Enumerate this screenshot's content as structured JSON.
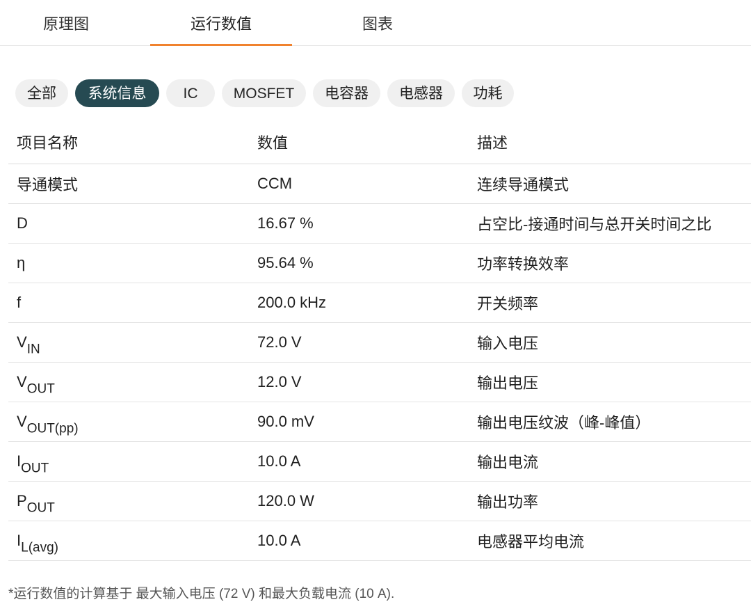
{
  "tabs": [
    {
      "label": "原理图",
      "active": false
    },
    {
      "label": "运行数值",
      "active": true
    },
    {
      "label": "图表",
      "active": false
    }
  ],
  "filters": [
    {
      "label": "全部",
      "active": false
    },
    {
      "label": "系统信息",
      "active": true
    },
    {
      "label": "IC",
      "active": false
    },
    {
      "label": "MOSFET",
      "active": false
    },
    {
      "label": "电容器",
      "active": false
    },
    {
      "label": "电感器",
      "active": false
    },
    {
      "label": "功耗",
      "active": false
    }
  ],
  "table": {
    "headers": [
      "项目名称",
      "数值",
      "描述"
    ],
    "rows": [
      {
        "symbol": "导通模式",
        "sub": "",
        "value": "CCM",
        "desc": "连续导通模式"
      },
      {
        "symbol": "D",
        "sub": "",
        "value": "16.67 %",
        "desc": "占空比-接通时间与总开关时间之比"
      },
      {
        "symbol": "η",
        "sub": "",
        "value": "95.64 %",
        "desc": "功率转换效率"
      },
      {
        "symbol": "f",
        "sub": "",
        "value": "200.0 kHz",
        "desc": "开关频率"
      },
      {
        "symbol": "V",
        "sub": "IN",
        "value": "72.0 V",
        "desc": "输入电压"
      },
      {
        "symbol": "V",
        "sub": "OUT",
        "value": "12.0 V",
        "desc": "输出电压"
      },
      {
        "symbol": "V",
        "sub": "OUT(pp)",
        "value": "90.0 mV",
        "desc": "输出电压纹波（峰-峰值）"
      },
      {
        "symbol": "I",
        "sub": "OUT",
        "value": "10.0 A",
        "desc": "输出电流"
      },
      {
        "symbol": "P",
        "sub": "OUT",
        "value": "120.0 W",
        "desc": "输出功率"
      },
      {
        "symbol": "I",
        "sub": "L(avg)",
        "value": "10.0 A",
        "desc": "电感器平均电流"
      }
    ]
  },
  "footnote": "*运行数值的计算基于 最大输入电压 (72 V) 和最大负载电流 (10 A).",
  "colors": {
    "accent": "#f0822e",
    "chip_active": "#264a52",
    "chip_bg": "#f0f0f0"
  }
}
